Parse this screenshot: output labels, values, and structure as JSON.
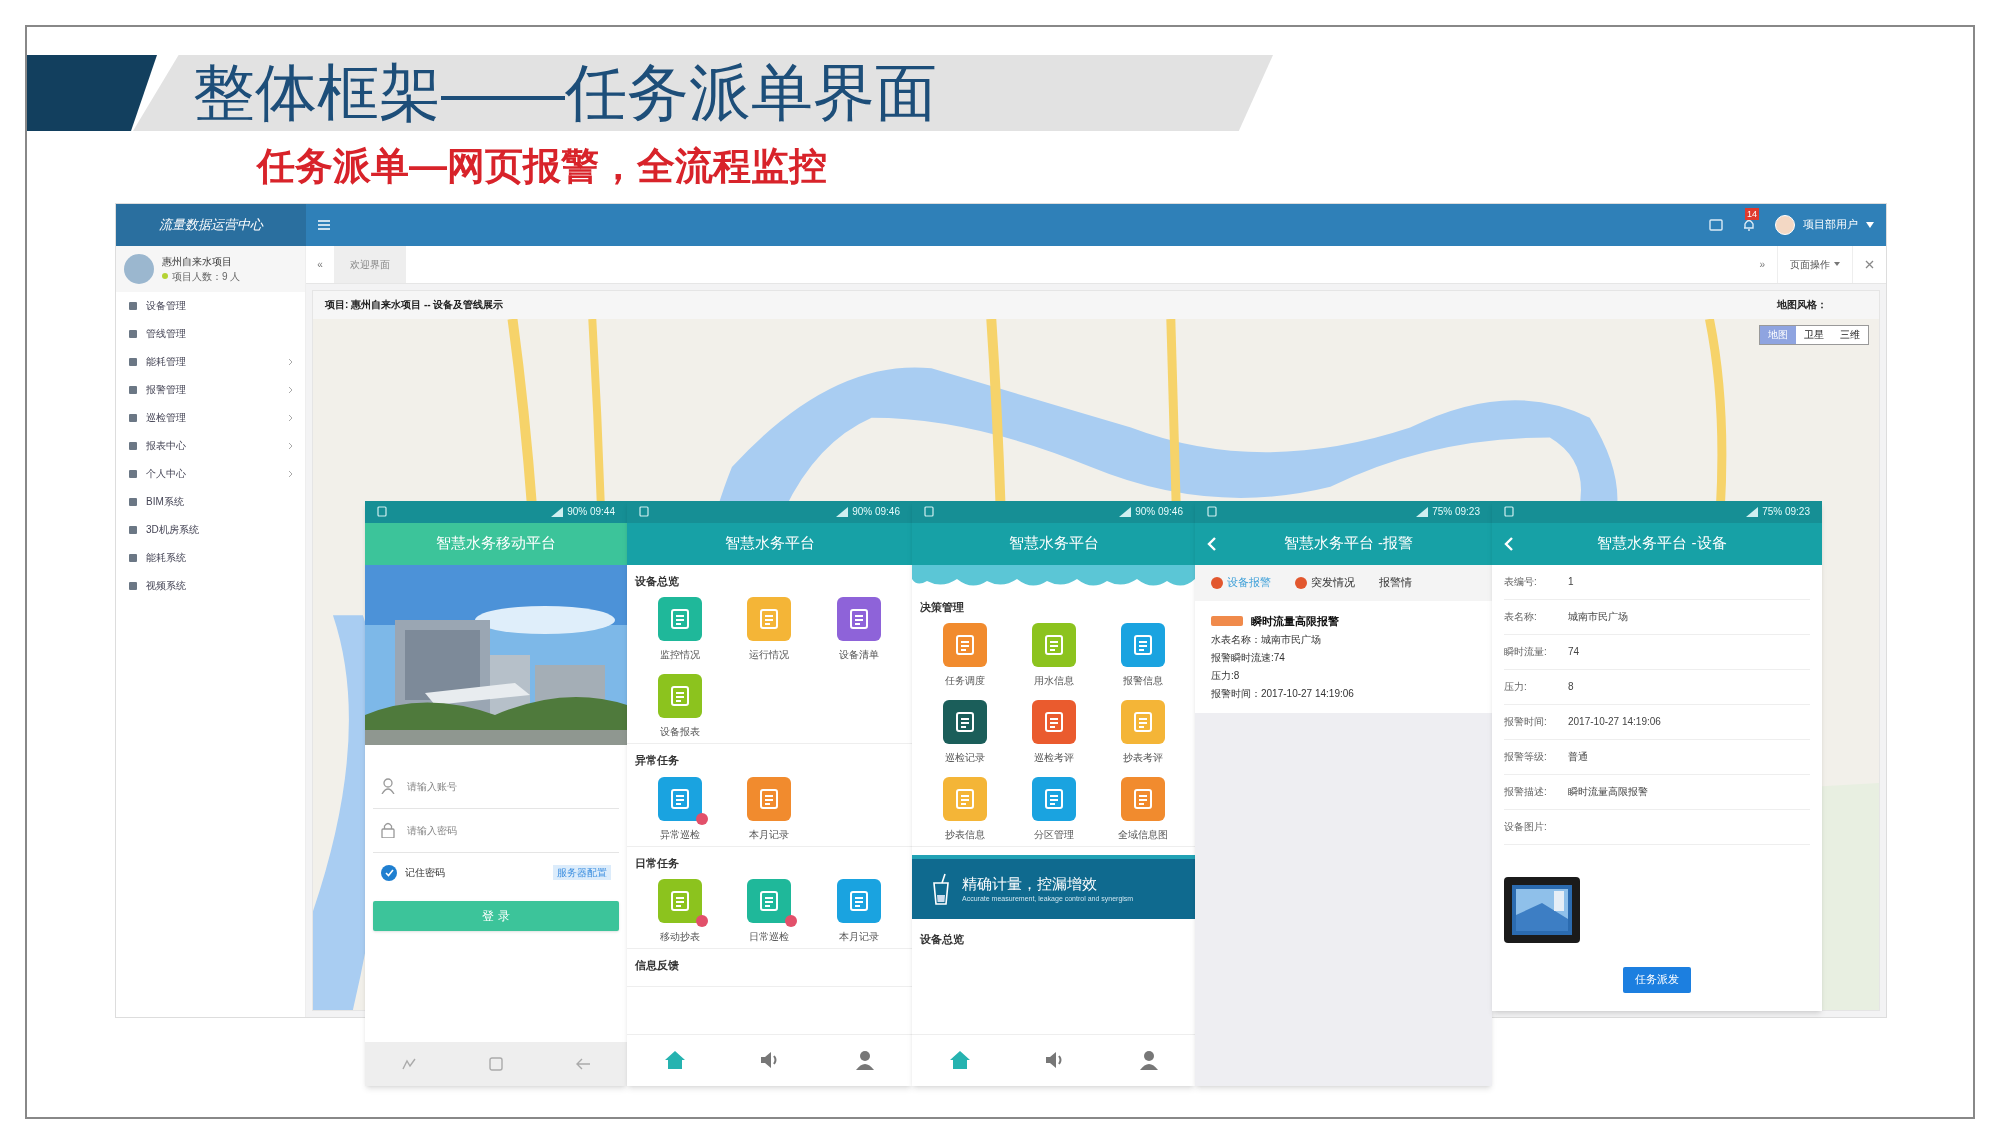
{
  "slide": {
    "title": "整体框架——任务派单界面",
    "subtitle": "任务派单—网页报警，全流程监控"
  },
  "web": {
    "logo": "流量数据运营中心",
    "project": "惠州自来水项目",
    "members": "项目人数：9 人",
    "badge": "14",
    "user": "项目部用户",
    "scroll_left": "«",
    "scroll_right": "»",
    "tab": "欢迎界面",
    "page_ops": "页面操作",
    "panel_title": "项目: 惠州自来水项目 -- 设备及管线展示",
    "map_style_label": "地图风格：",
    "map_styles": [
      {
        "label": "地图",
        "selected": true
      },
      {
        "label": "卫星",
        "selected": false
      },
      {
        "label": "三维",
        "selected": false
      }
    ],
    "sidebar": [
      {
        "label": "设备管理",
        "expandable": false
      },
      {
        "label": "管线管理",
        "expandable": false
      },
      {
        "label": "能耗管理",
        "expandable": true
      },
      {
        "label": "报警管理",
        "expandable": true
      },
      {
        "label": "巡检管理",
        "expandable": true
      },
      {
        "label": "报表中心",
        "expandable": true
      },
      {
        "label": "个人中心",
        "expandable": true
      },
      {
        "label": "BIM系统",
        "expandable": false
      },
      {
        "label": "3D机房系统",
        "expandable": false
      },
      {
        "label": "能耗系统",
        "expandable": false
      },
      {
        "label": "视频系统",
        "expandable": false
      }
    ]
  },
  "phones": [
    {
      "kind": "login",
      "status": "90% 09:44",
      "title": "智慧水务移动平台",
      "account_placeholder": "请输入账号",
      "password_placeholder": "请输入密码",
      "remember": {
        "label": "记住密码",
        "checked": true
      },
      "server_link": "服务器配置",
      "login_button": "登 录"
    },
    {
      "kind": "grid",
      "status": "90% 09:46",
      "title": "智慧水务平台",
      "sections": [
        {
          "title": "设备总览",
          "items": [
            {
              "label": "监控情况",
              "color": "#1fb89a",
              "badge": false
            },
            {
              "label": "运行情况",
              "color": "#f4b537",
              "badge": false
            },
            {
              "label": "设备清单",
              "color": "#8e63d9",
              "badge": false
            },
            {
              "label": "设备报表",
              "color": "#8cc31e",
              "badge": false
            }
          ]
        },
        {
          "title": "异常任务",
          "items": [
            {
              "label": "异常巡检",
              "color": "#1aa3e0",
              "badge": true
            },
            {
              "label": "本月记录",
              "color": "#f18b2e",
              "badge": false
            }
          ]
        },
        {
          "title": "日常任务",
          "items": [
            {
              "label": "移动抄表",
              "color": "#8cc31e",
              "badge": true
            },
            {
              "label": "日常巡检",
              "color": "#1fb89a",
              "badge": true
            },
            {
              "label": "本月记录",
              "color": "#1aa3e0",
              "badge": false
            }
          ]
        },
        {
          "title": "信息反馈"
        }
      ],
      "nav": [
        {
          "kind": "home",
          "selected": true
        },
        {
          "kind": "speaker",
          "selected": false
        },
        {
          "kind": "person",
          "selected": false
        }
      ]
    },
    {
      "kind": "dashboard",
      "status": "90% 09:46",
      "title": "智慧水务平台",
      "sections": [
        {
          "title": "决策管理",
          "items": [
            {
              "label": "任务调度",
              "color": "#f18b2e",
              "badge": false
            },
            {
              "label": "用水信息",
              "color": "#8cc31e",
              "badge": false
            },
            {
              "label": "报警信息",
              "color": "#1aa3e0",
              "badge": false
            },
            {
              "label": "巡检记录",
              "color": "#1b5e5a",
              "badge": false
            },
            {
              "label": "巡检考评",
              "color": "#ea5b2e",
              "badge": false
            },
            {
              "label": "抄表考评",
              "color": "#f4b537",
              "badge": false
            },
            {
              "label": "抄表信息",
              "color": "#f4b537",
              "badge": false
            },
            {
              "label": "分区管理",
              "color": "#1aa3e0",
              "badge": false
            },
            {
              "label": "全域信息图",
              "color": "#f18b2e",
              "badge": false
            }
          ]
        }
      ],
      "banner": {
        "title": "精确计量，控漏增效",
        "caption": "Accurate measurement, leakage control and synergism"
      },
      "footer_section": "设备总览",
      "nav": [
        {
          "kind": "home",
          "selected": true
        },
        {
          "kind": "speaker",
          "selected": false
        },
        {
          "kind": "person",
          "selected": false
        }
      ]
    },
    {
      "kind": "alarm",
      "status": "75% 09:23",
      "title": "智慧水务平台 -报警",
      "tabs": [
        {
          "label": "设备报警",
          "selected": true
        },
        {
          "label": "突发情况",
          "selected": false
        },
        {
          "label": "报警情",
          "selected": false
        }
      ],
      "card": {
        "title": "瞬时流量高限报警",
        "lines": [
          "水表名称：城南市民广场",
          "报警瞬时流速:74",
          "压力:8",
          "报警时间：2017-10-27 14:19:06"
        ]
      }
    },
    {
      "kind": "detail",
      "status": "75% 09:23",
      "title": "智慧水务平台 -设备",
      "rows": [
        {
          "label": "表编号:",
          "value": "1"
        },
        {
          "label": "表名称:",
          "value": "城南市民广场"
        },
        {
          "label": "瞬时流量:",
          "value": "74"
        },
        {
          "label": "压力:",
          "value": "8"
        },
        {
          "label": "报警时间:",
          "value": "2017-10-27 14:19:06"
        },
        {
          "label": "报警等级:",
          "value": "普通"
        },
        {
          "label": "报警描述:",
          "value": "瞬时流量高限报警"
        },
        {
          "label": "设备图片:"
        }
      ],
      "button": "任务派发"
    }
  ]
}
